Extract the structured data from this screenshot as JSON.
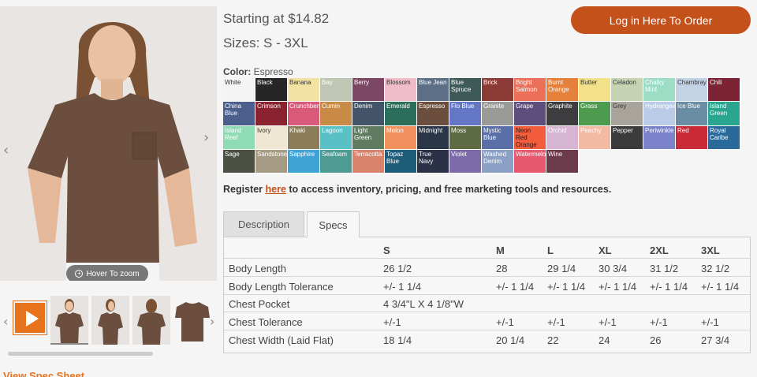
{
  "product": {
    "price_text": "Starting at $14.82",
    "sizes_text": "Sizes: S - 3XL",
    "color_label": "Color:",
    "color_value": "Espresso",
    "login_button": "Log in Here To Order",
    "hover_zoom": "Hover To zoom",
    "register_pre": "Register ",
    "register_link": "here",
    "register_post": " to access inventory, pricing, and free marketing tools and resources.",
    "view_spec_sheet": "View Spec Sheet",
    "shirt_color": "#6b4e3d"
  },
  "colors": [
    {
      "name": "White",
      "hex": "#f4f4f4",
      "text": "#333"
    },
    {
      "name": "Black",
      "hex": "#262626",
      "text": "#fff"
    },
    {
      "name": "Banana",
      "hex": "#f2e3a4",
      "text": "#333"
    },
    {
      "name": "Bay",
      "hex": "#bfc6b3",
      "text": "#fff"
    },
    {
      "name": "Berry",
      "hex": "#7b4763",
      "text": "#fff"
    },
    {
      "name": "Blossom",
      "hex": "#f1bcc9",
      "text": "#333"
    },
    {
      "name": "Blue Jean",
      "hex": "#5c6f87",
      "text": "#fff"
    },
    {
      "name": "Blue Spruce",
      "hex": "#3e5a58",
      "text": "#fff"
    },
    {
      "name": "Brick",
      "hex": "#8c3a36",
      "text": "#fff"
    },
    {
      "name": "Bright Salmon",
      "hex": "#ec6f5a",
      "text": "#fff"
    },
    {
      "name": "Burnt Orange",
      "hex": "#e5813a",
      "text": "#fff"
    },
    {
      "name": "Butter",
      "hex": "#f2e08a",
      "text": "#333"
    },
    {
      "name": "Celadon",
      "hex": "#c6d4b3",
      "text": "#333"
    },
    {
      "name": "Chalky Mint",
      "hex": "#9ddcc5",
      "text": "#fff"
    },
    {
      "name": "Chambray",
      "hex": "#c3d3e5",
      "text": "#333"
    },
    {
      "name": "Chili",
      "hex": "#7d2434",
      "text": "#fff"
    },
    {
      "name": "China Blue",
      "hex": "#4b5f8c",
      "text": "#fff"
    },
    {
      "name": "Crimson",
      "hex": "#8b2230",
      "text": "#fff"
    },
    {
      "name": "Crunchberry",
      "hex": "#d9597a",
      "text": "#fff"
    },
    {
      "name": "Cumin",
      "hex": "#c98a46",
      "text": "#fff"
    },
    {
      "name": "Denim",
      "hex": "#445468",
      "text": "#fff"
    },
    {
      "name": "Emerald",
      "hex": "#2c6e5a",
      "text": "#fff"
    },
    {
      "name": "Espresso",
      "hex": "#6b4e3d",
      "text": "#fff"
    },
    {
      "name": "Flo Blue",
      "hex": "#6477c7",
      "text": "#fff"
    },
    {
      "name": "Granite",
      "hex": "#9a9a98",
      "text": "#fff"
    },
    {
      "name": "Grape",
      "hex": "#5e4e7d",
      "text": "#fff"
    },
    {
      "name": "Graphite",
      "hex": "#3d3d3f",
      "text": "#fff"
    },
    {
      "name": "Grass",
      "hex": "#4e9a4e",
      "text": "#fff"
    },
    {
      "name": "Grey",
      "hex": "#a8a49c",
      "text": "#333"
    },
    {
      "name": "Hydrangea",
      "hex": "#b9cbe7",
      "text": "#fff"
    },
    {
      "name": "Ice Blue",
      "hex": "#6b8da3",
      "text": "#fff"
    },
    {
      "name": "Island Green",
      "hex": "#2aa58f",
      "text": "#fff"
    },
    {
      "name": "Island Reef",
      "hex": "#8fdbb5",
      "text": "#fff"
    },
    {
      "name": "Ivory",
      "hex": "#efe7d3",
      "text": "#333"
    },
    {
      "name": "Khaki",
      "hex": "#8c7c5a",
      "text": "#fff"
    },
    {
      "name": "Lagoon",
      "hex": "#59c1c5",
      "text": "#fff"
    },
    {
      "name": "Light Green",
      "hex": "#5f7c60",
      "text": "#fff"
    },
    {
      "name": "Melon",
      "hex": "#f1915e",
      "text": "#fff"
    },
    {
      "name": "Midnight",
      "hex": "#2a3547",
      "text": "#fff"
    },
    {
      "name": "Moss",
      "hex": "#5e6b44",
      "text": "#fff"
    },
    {
      "name": "Mystic Blue",
      "hex": "#5a6ea8",
      "text": "#fff"
    },
    {
      "name": "Neon Red Orange",
      "hex": "#f25c3c",
      "text": "#222"
    },
    {
      "name": "Orchid",
      "hex": "#d6b5d3",
      "text": "#fff"
    },
    {
      "name": "Peachy",
      "hex": "#f2b9a3",
      "text": "#fff"
    },
    {
      "name": "Pepper",
      "hex": "#3b3b3b",
      "text": "#fff"
    },
    {
      "name": "Periwinkle",
      "hex": "#7a82c9",
      "text": "#fff"
    },
    {
      "name": "Red",
      "hex": "#c92a37",
      "text": "#fff"
    },
    {
      "name": "Royal Caribe",
      "hex": "#2a6a9a",
      "text": "#fff"
    },
    {
      "name": "Sage",
      "hex": "#4b5043",
      "text": "#fff"
    },
    {
      "name": "Sandstone",
      "hex": "#a59c83",
      "text": "#fff"
    },
    {
      "name": "Sapphire",
      "hex": "#3fa3d6",
      "text": "#fff"
    },
    {
      "name": "Seafoam",
      "hex": "#4d9b93",
      "text": "#fff"
    },
    {
      "name": "Terracotta",
      "hex": "#d9836c",
      "text": "#fff"
    },
    {
      "name": "Topaz Blue",
      "hex": "#1f5e7a",
      "text": "#fff"
    },
    {
      "name": "True Navy",
      "hex": "#2b3146",
      "text": "#fff"
    },
    {
      "name": "Violet",
      "hex": "#7c6ba8",
      "text": "#fff"
    },
    {
      "name": "Washed Denim",
      "hex": "#8aa0c4",
      "text": "#fff"
    },
    {
      "name": "Watermelon",
      "hex": "#e6596e",
      "text": "#fff"
    },
    {
      "name": "Wine",
      "hex": "#6b3a4b",
      "text": "#fff"
    }
  ],
  "tabs": {
    "description": "Description",
    "specs": "Specs"
  },
  "specs": {
    "headers": [
      "",
      "S",
      "M",
      "L",
      "XL",
      "2XL",
      "3XL"
    ],
    "rows": [
      {
        "label": "Body Length",
        "values": [
          "26 1/2",
          "28",
          "29 1/4",
          "30 3/4",
          "31 1/2",
          "32 1/2"
        ]
      },
      {
        "label": "Body Length Tolerance",
        "values": [
          "+/- 1 1/4",
          "+/- 1 1/4",
          "+/- 1 1/4",
          "+/- 1 1/4",
          "+/- 1 1/4",
          "+/- 1 1/4"
        ]
      },
      {
        "label": "Chest Pocket",
        "values": [
          "4 3/4\"L X 4 1/8\"W",
          "",
          "",
          "",
          "",
          ""
        ]
      },
      {
        "label": "Chest Tolerance",
        "values": [
          "+/-1",
          "+/-1",
          "+/-1",
          "+/-1",
          "+/-1",
          "+/-1"
        ]
      },
      {
        "label": "Chest Width (Laid Flat)",
        "values": [
          "18 1/4",
          "20 1/4",
          "22",
          "24",
          "26",
          "27 3/4"
        ]
      }
    ]
  },
  "icons": {
    "prev": "chevron-left-icon",
    "next": "chevron-right-icon",
    "zoom": "plus-circle-icon",
    "play": "play-icon"
  }
}
